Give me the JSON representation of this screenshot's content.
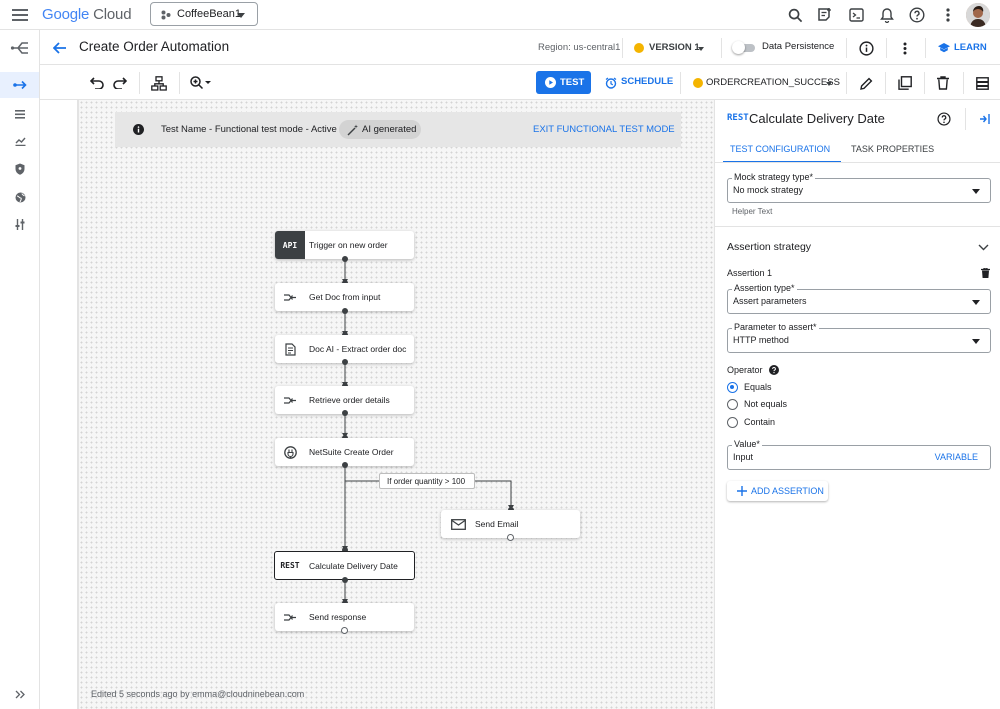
{
  "topbar": {
    "logo_google": "Google",
    "logo_cloud": "Cloud",
    "project": "CoffeeBean1"
  },
  "titlebar": {
    "title": "Create Order Automation",
    "region": "Region: us-central1",
    "version": "VERSION 1",
    "data_persistence": "Data Persistence",
    "learn": "LEARN"
  },
  "toolbar": {
    "test": "TEST",
    "schedule": "SCHEDULE",
    "status": "ORDERCREATION_SUCCESS"
  },
  "banner": {
    "text": "Test Name - Functional test mode - Active",
    "chip": "AI generated",
    "exit": "EXIT FUNCTIONAL TEST MODE"
  },
  "flow": {
    "nodes": [
      {
        "id": "trigger",
        "label": "Trigger on new order",
        "icon": "API"
      },
      {
        "id": "getdoc",
        "label": "Get Doc from input",
        "icon": "data-mapping-icon"
      },
      {
        "id": "docai",
        "label": "Doc AI - Extract order doc",
        "icon": "document-icon"
      },
      {
        "id": "retrieve",
        "label": "Retrieve order details",
        "icon": "data-mapping-icon"
      },
      {
        "id": "netsuite",
        "label": "NetSuite Create Order",
        "icon": "connector-icon"
      },
      {
        "id": "email",
        "label": "Send Email",
        "icon": "mail-icon"
      },
      {
        "id": "calc",
        "label": "Calculate Delivery Date",
        "icon": "REST"
      },
      {
        "id": "response",
        "label": "Send response",
        "icon": "data-mapping-icon"
      }
    ],
    "edge_label": "If order quantity > 100"
  },
  "footer": {
    "edited": "Edited 5 seconds ago by emma@cloudninebean.com"
  },
  "panel": {
    "rest_tag": "REST",
    "title": "Calculate Delivery Date",
    "tabs": [
      "TEST CONFIGURATION",
      "TASK PROPERTIES"
    ],
    "mock_label": "Mock strategy type*",
    "mock_value": "No mock strategy",
    "helper": "Helper Text",
    "assertion_strategy": "Assertion strategy",
    "assertion_1": "Assertion 1",
    "assertion_type_label": "Assertion type*",
    "assertion_type_value": "Assert parameters",
    "param_label": "Parameter to assert*",
    "param_value": "HTTP method",
    "operator": "Operator",
    "options": [
      "Equals",
      "Not equals",
      "Contain"
    ],
    "selected_option": "Equals",
    "value_label": "Value*",
    "value_value": "Input",
    "variable": "VARIABLE",
    "add_assertion": "ADD ASSERTION"
  },
  "colors": {
    "accent": "#1a73e8",
    "status_yellow": "#f4b400",
    "node_icon_dark": "#3c4043"
  }
}
